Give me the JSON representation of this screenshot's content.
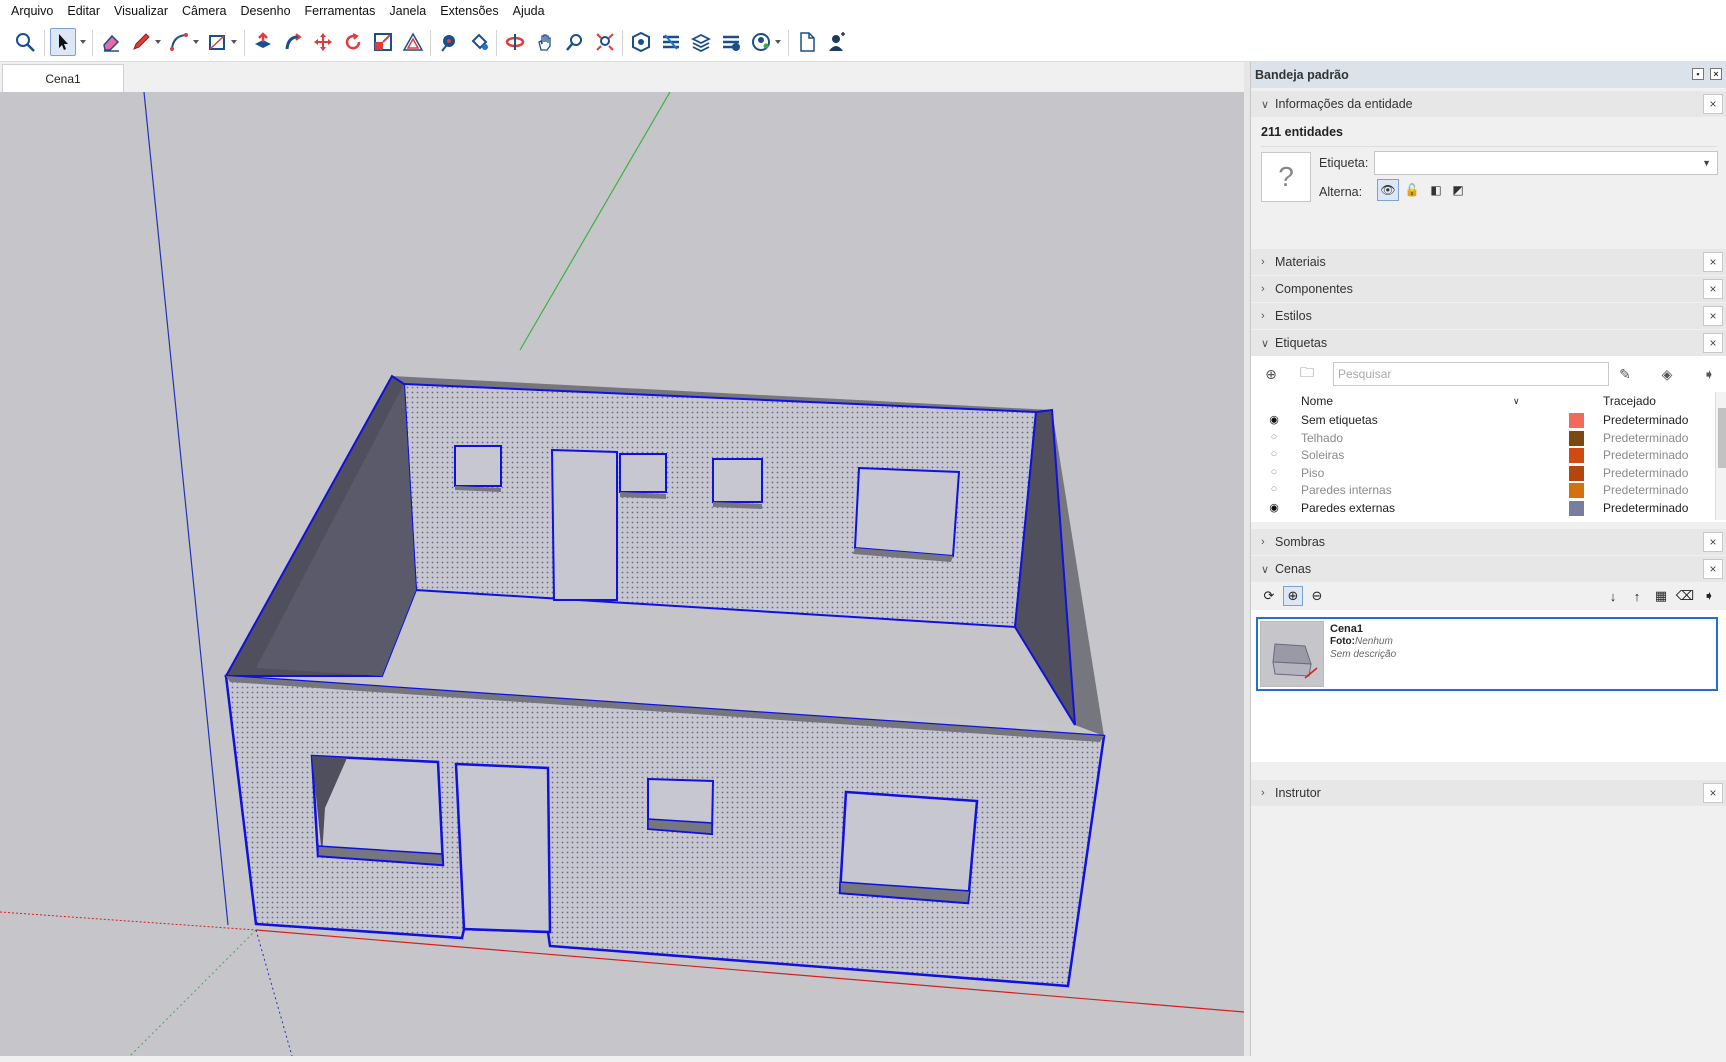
{
  "menu": [
    "Arquivo",
    "Editar",
    "Visualizar",
    "Câmera",
    "Desenho",
    "Ferramentas",
    "Janela",
    "Extensões",
    "Ajuda"
  ],
  "toolbar": {
    "tools": [
      "search-icon",
      "select-icon",
      "eraser-icon",
      "pencil-icon",
      "arc-icon",
      "rectangle-icon",
      "push-pull-icon",
      "follow-me-icon",
      "move-icon",
      "rotate-icon",
      "scale-icon",
      "offset-icon",
      "tape-measure-icon",
      "paint-bucket-icon",
      "orbit-icon",
      "pan-icon",
      "zoom-icon",
      "zoom-extents-icon",
      "warehouse-icon",
      "extension-warehouse-icon",
      "layout-icon",
      "sandbox-icon",
      "account-icon",
      "new-file-icon",
      "user-icon"
    ]
  },
  "scene_tab": "Cena1",
  "tray": {
    "title": "Bandeja padrão",
    "entity_info": {
      "header": "Informações da entidade",
      "count": "211 entidades",
      "tag_label": "Etiqueta:",
      "toggle_label": "Alterna:"
    },
    "panels": {
      "materials": "Materiais",
      "components": "Componentes",
      "styles": "Estilos",
      "tags": "Etiquetas",
      "shadows": "Sombras",
      "scenes": "Cenas",
      "instructor": "Instrutor"
    },
    "tags": {
      "search_placeholder": "Pesquisar",
      "col_name": "Nome",
      "col_dash": "Tracejado",
      "rows": [
        {
          "name": "Sem etiquetas",
          "visible": true,
          "color": "#f26a5c",
          "dash": "Predeterminado"
        },
        {
          "name": "Telhado",
          "visible": false,
          "color": "#7a4a12",
          "dash": "Predeterminado"
        },
        {
          "name": "Soleiras",
          "visible": false,
          "color": "#d14a0f",
          "dash": "Predeterminado"
        },
        {
          "name": "Piso",
          "visible": false,
          "color": "#b5450d",
          "dash": "Predeterminado"
        },
        {
          "name": "Paredes internas",
          "visible": false,
          "color": "#d4700f",
          "dash": "Predeterminado"
        },
        {
          "name": "Paredes externas",
          "visible": true,
          "color": "#7a7e9e",
          "dash": "Predeterminado"
        }
      ]
    },
    "scenes": {
      "name": "Cena1",
      "photo_label": "Foto:",
      "photo_value": "Nenhum",
      "description": "Sem descrição"
    }
  }
}
